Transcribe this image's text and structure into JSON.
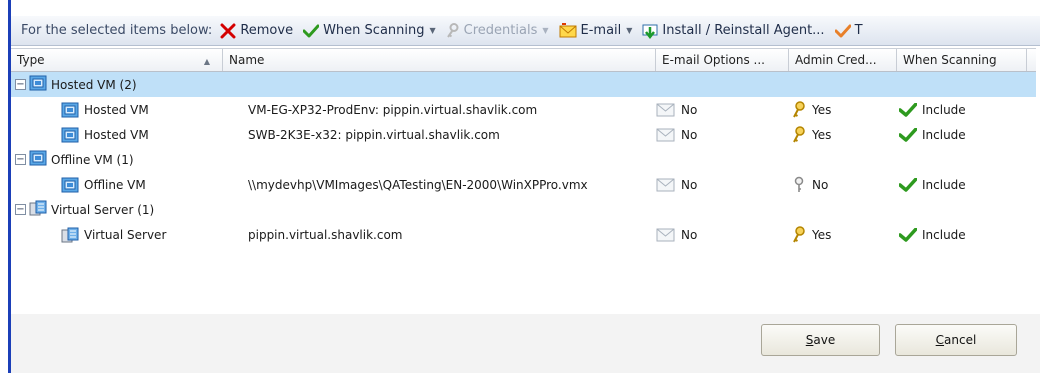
{
  "toolbar": {
    "lead": "For the selected items below:",
    "items": [
      {
        "label": "Remove",
        "icon": "red-x-icon",
        "disabled": false,
        "caret": false
      },
      {
        "label": "When Scanning",
        "icon": "green-check-icon",
        "disabled": false,
        "caret": true
      },
      {
        "label": "Credentials",
        "icon": "key-icon",
        "disabled": true,
        "caret": true
      },
      {
        "label": "E-mail",
        "icon": "email-icon",
        "disabled": false,
        "caret": true
      },
      {
        "label": "Install / Reinstall Agent...",
        "icon": "install-icon",
        "disabled": false,
        "caret": false
      },
      {
        "label": "T",
        "icon": "orange-check-icon",
        "disabled": false,
        "caret": false
      }
    ]
  },
  "columns": {
    "type": "Type",
    "name": "Name",
    "email": "E-mail Options ...",
    "admin": "Admin Cred...",
    "scan": "When Scanning"
  },
  "groups": [
    {
      "label": "Hosted VM (2)",
      "icon": "hosted-vm-icon",
      "items": [
        {
          "type": "Hosted VM",
          "name": "VM-EG-XP32-ProdEnv: pippin.virtual.shavlik.com",
          "email": "No",
          "admin": "Yes",
          "scan": "Include"
        },
        {
          "type": "Hosted VM",
          "name": "SWB-2K3E-x32: pippin.virtual.shavlik.com",
          "email": "No",
          "admin": "Yes",
          "scan": "Include"
        }
      ]
    },
    {
      "label": "Offline VM (1)",
      "icon": "offline-vm-icon",
      "items": [
        {
          "type": "Offline VM",
          "name": "\\\\mydevhp\\VMImages\\QATesting\\EN-2000\\WinXPPro.vmx",
          "email": "No",
          "admin": "No",
          "scan": "Include"
        }
      ]
    },
    {
      "label": "Virtual Server (1)",
      "icon": "virtual-server-icon",
      "items": [
        {
          "type": "Virtual Server",
          "name": "pippin.virtual.shavlik.com",
          "email": "No",
          "admin": "Yes",
          "scan": "Include"
        }
      ]
    }
  ],
  "buttons": {
    "save": "Save",
    "cancel": "Cancel"
  },
  "colors": {
    "selection": "#bfe0f8",
    "accent_border": "#1b3fb8",
    "include_check": "#2e9a1f",
    "remove_x": "#d40000"
  }
}
